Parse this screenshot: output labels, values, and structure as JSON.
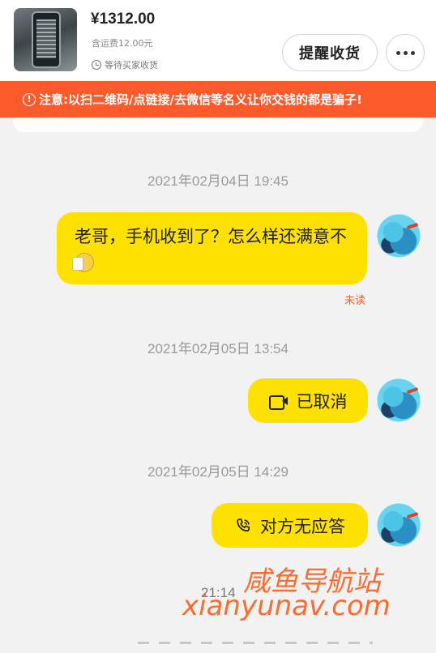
{
  "order": {
    "price": "¥1312.00",
    "shipping": "含运费12.00元",
    "status": "等待买家收货",
    "remind_label": "提醒收货",
    "status_icon": "clock-icon",
    "more_icon": "more-dots-icon"
  },
  "warning": {
    "text": "注意:以扫二维码/点链接/去微信等名义让你交钱的都是骗子!",
    "icon": "exclamation-circle-icon",
    "color": "#ff5a2b"
  },
  "messages": [
    {
      "timestamp": "2021年02月04日 19:45",
      "side": "left",
      "text": "老哥，手机收到了？怎么样还满意不",
      "emoji": "wiping-sweat-emoji",
      "read_status": "未读"
    },
    {
      "timestamp": "2021年02月05日 13:54",
      "side": "right",
      "icon": "video-call-icon",
      "text": "已取消"
    },
    {
      "timestamp": "2021年02月05日 14:29",
      "side": "right",
      "icon": "phone-call-icon",
      "text": "对方无应答"
    }
  ],
  "bottom_time": "21:14",
  "watermark": {
    "cn": "咸鱼导航站",
    "en": "xianyunav.com"
  },
  "colors": {
    "bubble": "#ffe100",
    "background": "#f2f2f2",
    "accent": "#ff5a2b"
  }
}
